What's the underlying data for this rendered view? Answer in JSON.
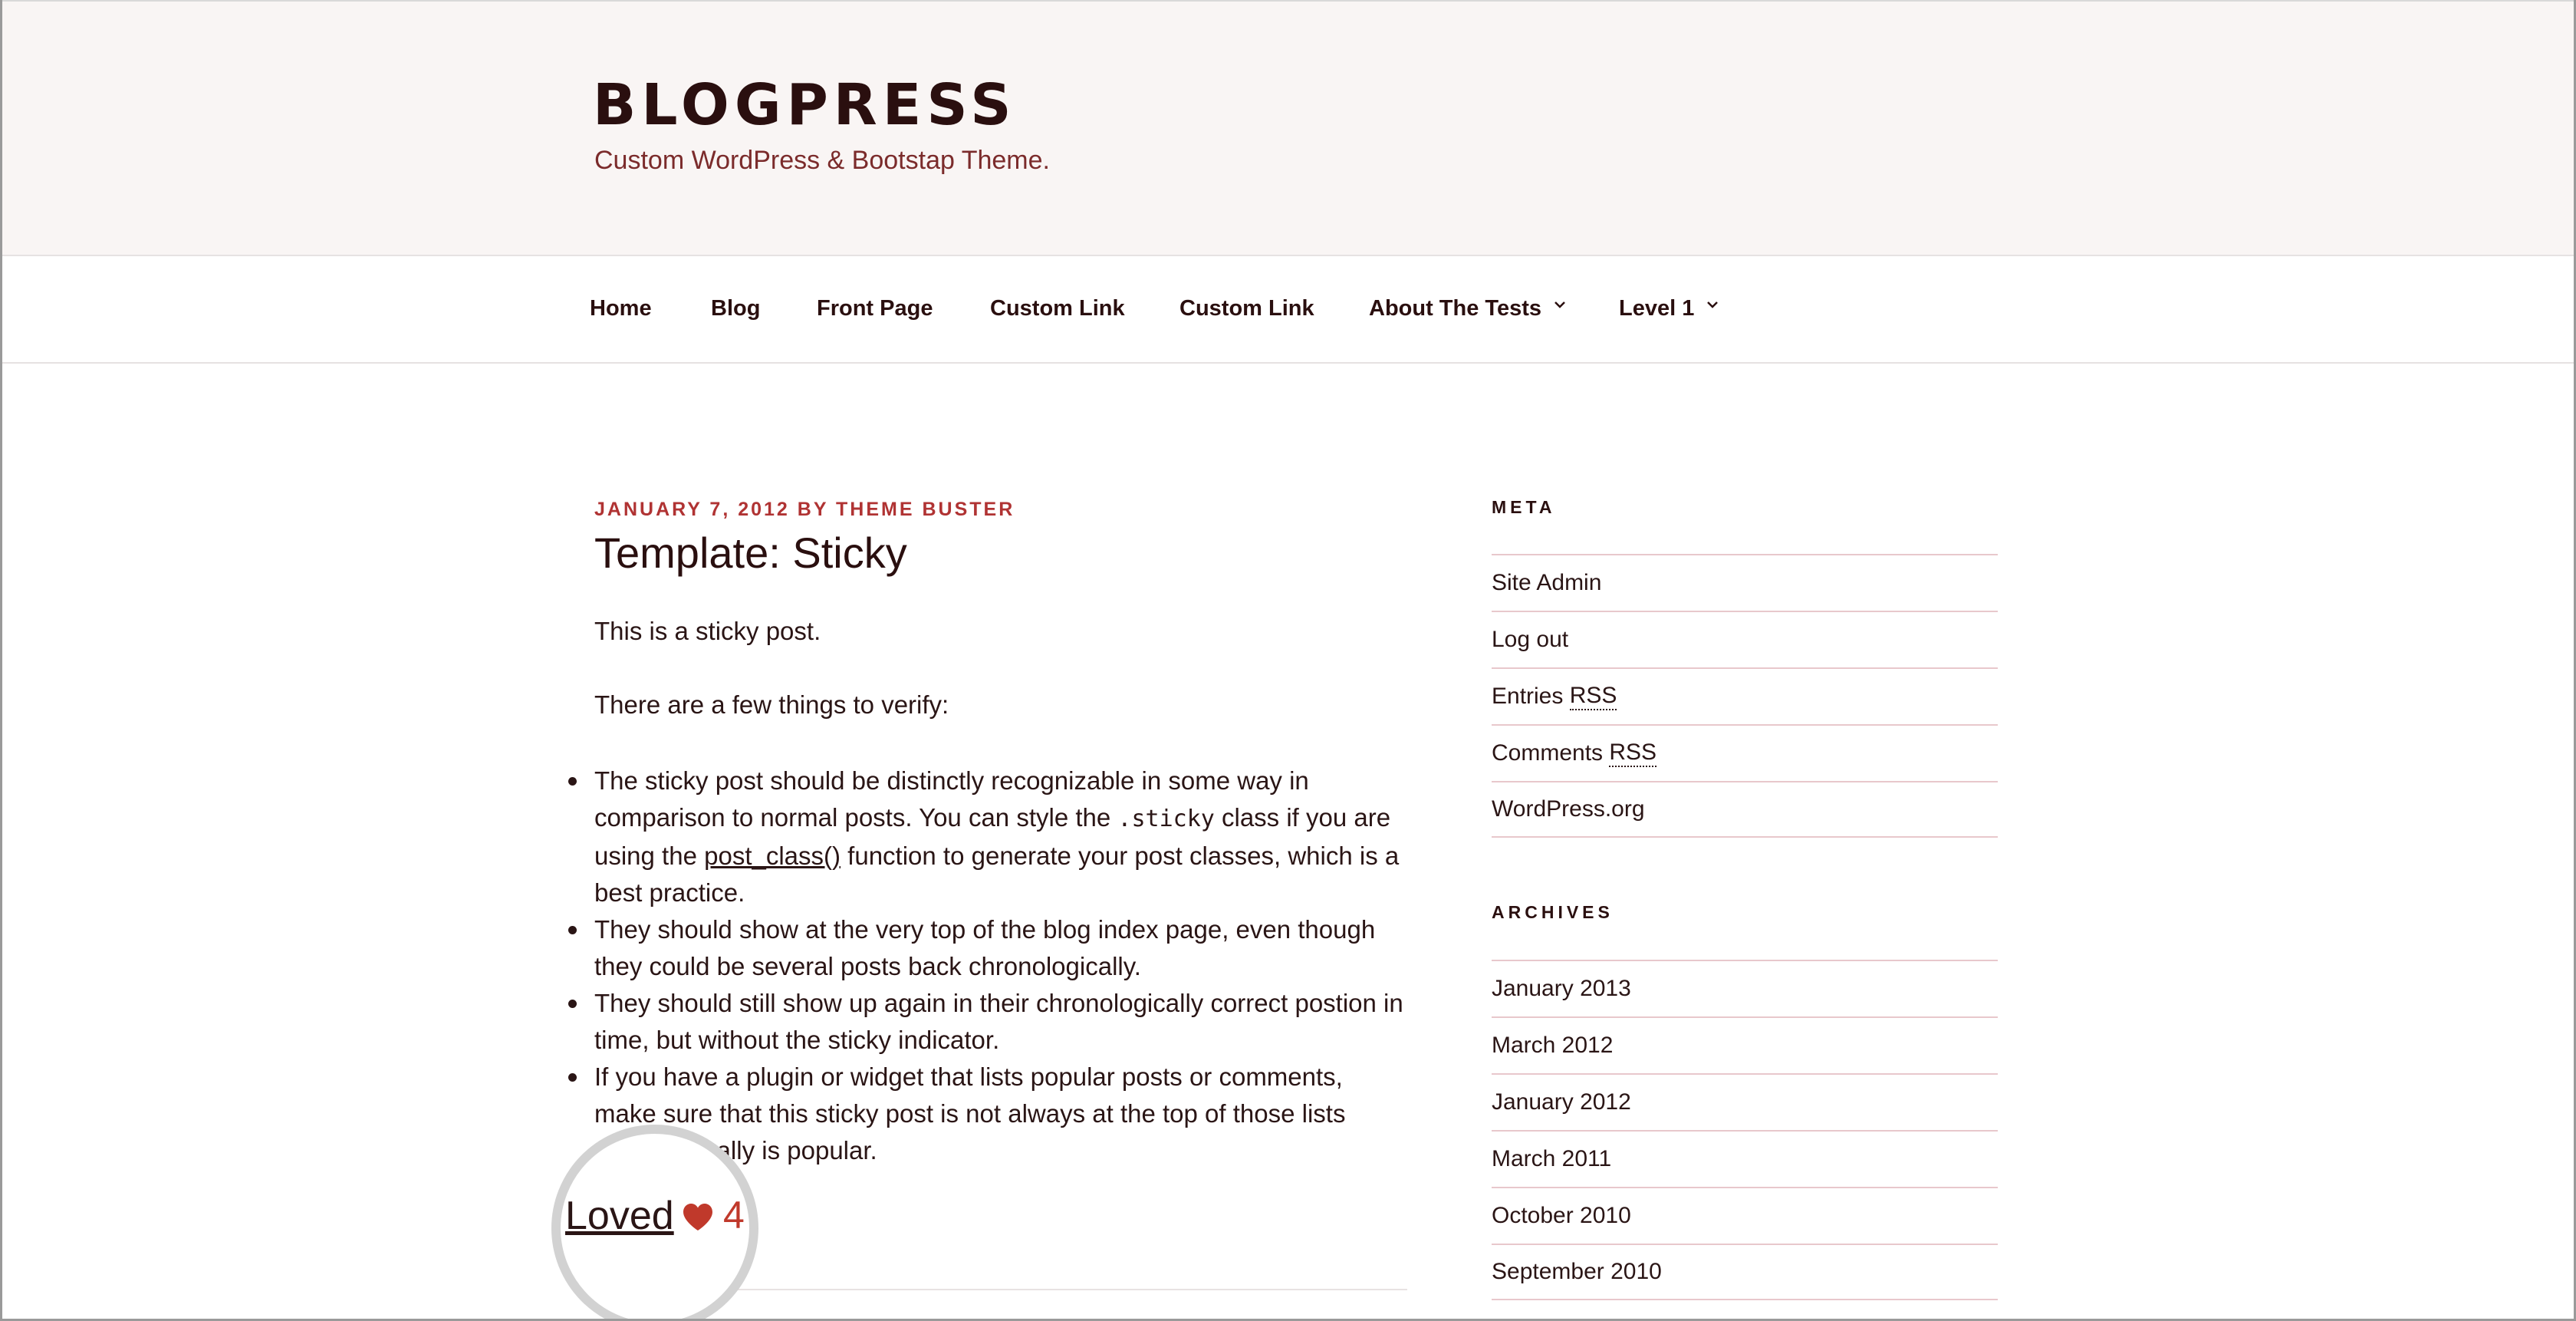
{
  "header": {
    "site_title": "BLOGPRESS",
    "site_description": "Custom WordPress & Bootstap Theme."
  },
  "nav": {
    "items": [
      {
        "label": "Home"
      },
      {
        "label": "Blog"
      },
      {
        "label": "Front Page"
      },
      {
        "label": "Custom Link"
      },
      {
        "label": "Custom Link"
      },
      {
        "label": "About The Tests",
        "has_submenu": true
      },
      {
        "label": "Level 1",
        "has_submenu": true
      }
    ]
  },
  "post": {
    "date": "JANUARY 7, 2012",
    "by": "BY",
    "author": "THEME BUSTER",
    "title": "Template: Sticky",
    "intro": "This is a sticky post.",
    "lead": "There are a few things to verify:",
    "bullets": {
      "b1_part1": "The sticky post should be distinctly recognizable in some way in comparison to normal posts. You can style the ",
      "b1_code": ".sticky",
      "b1_part2": " class if you are using the ",
      "b1_link": "post_class()",
      "b1_part3": " function to generate your post classes, which is a best practice.",
      "b2": "They should show at the very top of the blog index page, even though they could be several posts back chronologically.",
      "b3": "They should still show up again in their chronologically correct postion in time, but without the sticky indicator.",
      "b4": "If you have a plugin or widget that lists popular posts or comments, make sure that this sticky post is not always at the top of those lists unless it really is popular."
    },
    "loved": {
      "label": "Loved",
      "count": "4",
      "heart_icon": "heart-icon",
      "heart_color": "#c0392b"
    }
  },
  "sidebar": {
    "meta": {
      "title": "META",
      "items": [
        {
          "label": "Site Admin"
        },
        {
          "label": "Log out"
        },
        {
          "label": "Entries ",
          "abbr": "RSS"
        },
        {
          "label": "Comments ",
          "abbr": "RSS"
        },
        {
          "label": "WordPress.org"
        }
      ]
    },
    "archives": {
      "title": "ARCHIVES",
      "items": [
        {
          "label": "January 2013"
        },
        {
          "label": "March 2012"
        },
        {
          "label": "January 2012"
        },
        {
          "label": "March 2011"
        },
        {
          "label": "October 2010"
        },
        {
          "label": "September 2010"
        }
      ]
    }
  },
  "colors": {
    "accent": "#b03333",
    "header_bg": "#f9f5f4",
    "text": "#2a1515",
    "divider": "#e8c8cc"
  }
}
